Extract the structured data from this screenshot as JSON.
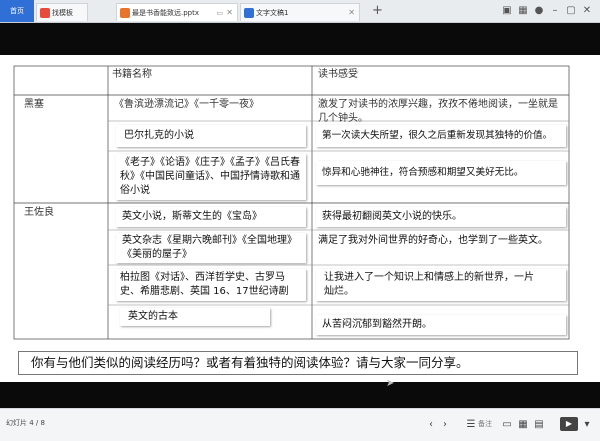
{
  "tabs": {
    "home": "首页",
    "docs": [
      {
        "label": "找模板",
        "icon_color": "#e84b3c"
      },
      {
        "label": "最是书香能致远.pptx",
        "icon_color": "#e8742c"
      },
      {
        "label": "文字文稿1",
        "icon_color": "#2f6fd6"
      }
    ],
    "add": "+"
  },
  "table": {
    "headers": [
      "书籍名称",
      "读书感受"
    ],
    "persons": [
      "黑塞",
      "王佐良"
    ],
    "rows": [
      {
        "book": "《鲁滨逊漂流记》《一千零一夜》",
        "feeling": "激发了对读书的浓厚兴趣，孜孜不倦地阅读，一坐就是几个钟头。"
      },
      {
        "book": "巴尔扎克的小说",
        "feeling": "第一次读大失所望，很久之后重新发现其独特的价值。"
      },
      {
        "book": "《老子》《论语》《庄子》《孟子》《吕氏春秋》《中国民间童话》、中国抒情诗歌和通俗小说",
        "feeling": "惊异和心驰神往，符合预感和期望又美好无比。"
      },
      {
        "book": "英文小说，斯蒂文生的《宝岛》",
        "feeling": "获得最初翻阅英文小说的快乐。"
      },
      {
        "book": "英文杂志《星期六晚邮刊》《全国地理》《美丽的屋子》",
        "feeling": "满足了我对外间世界的好奇心，也学到了一些英文。"
      },
      {
        "book": "柏拉图《对话》、西洋哲学史、古罗马史、希腊悲剧、英国 16、17世纪诗剧",
        "feeling": "让我进入了一个知识上和情感上的新世界，一片灿烂。"
      },
      {
        "book": "英文的古本",
        "feeling": "从苦闷沉郁到豁然开朗。"
      }
    ]
  },
  "question": "你有与他们类似的阅读经历吗？或者有着独特的阅读体验？请与大家一同分享。",
  "status": {
    "slide_count": "幻灯片 4 / 8",
    "note_label": "备注"
  }
}
